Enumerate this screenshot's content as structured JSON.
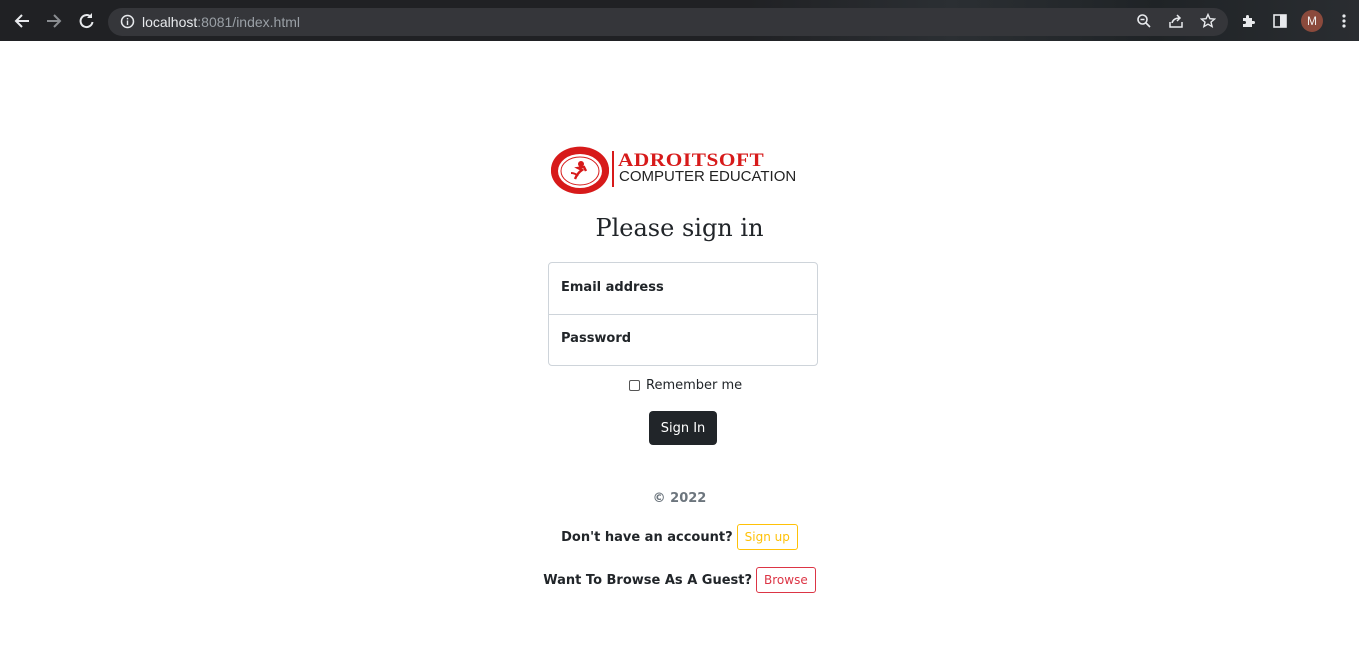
{
  "browser": {
    "url_host": "localhost",
    "url_rest": ":8081/index.html",
    "avatar_letter": "M",
    "icons": [
      "back-icon",
      "forward-icon",
      "reload-icon",
      "info-icon",
      "zoom-icon",
      "share-icon",
      "star-icon",
      "extensions-icon",
      "sidepanel-icon",
      "kebab-menu-icon"
    ]
  },
  "logo": {
    "brand": "ADROITSOFT",
    "subtitle": "COMPUTER EDUCATION",
    "brand_color": "#d71a1a"
  },
  "form": {
    "title": "Please sign in",
    "email_label": "Email address",
    "password_label": "Password",
    "remember_label": "Remember me",
    "submit_label": "Sign In"
  },
  "footer": {
    "copyright": "© 2022",
    "signup_question": "Don't have an account?",
    "signup_label": "Sign up",
    "guest_question": "Want To Browse As A Guest?",
    "browse_label": "Browse"
  },
  "colors": {
    "warning": "#ffc107",
    "danger": "#dc3545",
    "dark": "#212529"
  }
}
